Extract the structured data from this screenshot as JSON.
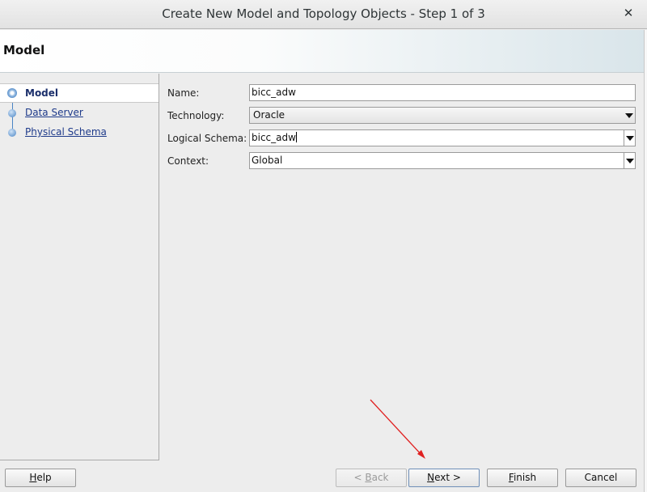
{
  "window": {
    "title": "Create New Model and Topology Objects - Step 1 of 3",
    "close_glyph": "✕"
  },
  "header": {
    "title": "Model"
  },
  "nav": {
    "items": [
      {
        "label": "Model"
      },
      {
        "label": "Data Server"
      },
      {
        "label": "Physical Schema"
      }
    ]
  },
  "form": {
    "name": {
      "label": "Name:",
      "value": "bicc_adw"
    },
    "technology": {
      "label": "Technology:",
      "value": "Oracle"
    },
    "logical_schema": {
      "label": "Logical Schema:",
      "value": "bicc_adw"
    },
    "context": {
      "label": "Context:",
      "value": "Global"
    }
  },
  "buttons": {
    "help": {
      "pre": "",
      "mnemonic": "H",
      "post": "elp"
    },
    "back": {
      "pre": "< ",
      "mnemonic": "B",
      "post": "ack"
    },
    "next": {
      "pre": "",
      "mnemonic": "N",
      "post": "ext >"
    },
    "finish": {
      "pre": "",
      "mnemonic": "F",
      "post": "inish"
    },
    "cancel": {
      "pre": "",
      "mnemonic": "",
      "post": "Cancel"
    }
  },
  "colors": {
    "annotation_arrow": "#e02020",
    "link": "#1e3a8a",
    "step_node": "#4a84c4"
  },
  "icons": [
    "close-icon",
    "step-node-icon",
    "dropdown-arrow-icon"
  ]
}
